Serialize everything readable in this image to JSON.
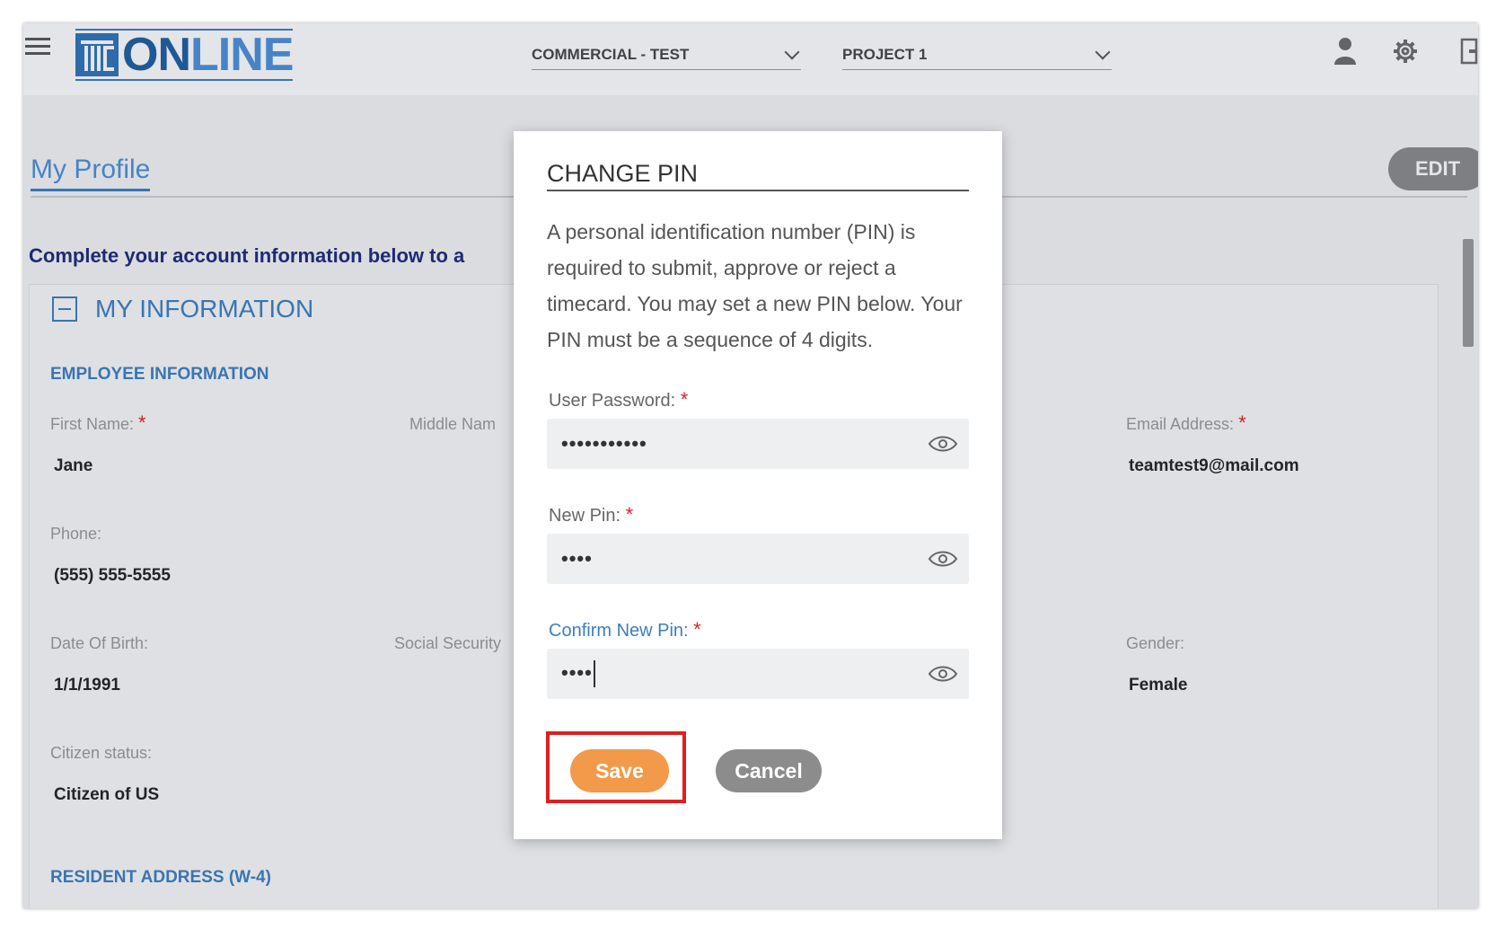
{
  "header": {
    "logo_text_1": "ON",
    "logo_text_2": "LINE",
    "company_select": "COMMERCIAL - TEST",
    "project_select": "PROJECT 1"
  },
  "page": {
    "tab": "My Profile",
    "edit_label": "EDIT",
    "intro": "Complete your account information below to a",
    "section_title": "MY INFORMATION",
    "employee_info_heading": "EMPLOYEE INFORMATION",
    "resident_address_heading": "RESIDENT ADDRESS (W-4)"
  },
  "fields": {
    "first_name": {
      "label": "First Name:",
      "value": "Jane"
    },
    "middle_name": {
      "label": "Middle Nam"
    },
    "email": {
      "label": "Email Address:",
      "value": "teamtest9@mail.com"
    },
    "phone": {
      "label": "Phone:",
      "value": "(555) 555-5555"
    },
    "dob": {
      "label": "Date Of Birth:",
      "value": "1/1/1991"
    },
    "ssn": {
      "label": "Social Security"
    },
    "gender": {
      "label": "Gender:",
      "value": "Female"
    },
    "citizen": {
      "label": "Citizen status:",
      "value": "Citizen of US"
    }
  },
  "modal": {
    "title": "CHANGE PIN",
    "description": "A personal identification number (PIN) is required to submit, approve or reject a timecard. You may set a new PIN below. Your PIN must be a sequence of 4 digits.",
    "user_password_label": "User Password:",
    "user_password_value": "•••••••••••",
    "new_pin_label": "New Pin:",
    "new_pin_value": "••••",
    "confirm_pin_label": "Confirm New Pin:",
    "confirm_pin_value": "••••",
    "save_label": "Save",
    "cancel_label": "Cancel",
    "required_mark": "*"
  },
  "colors": {
    "accent": "#3a7fc1",
    "save": "#f29a4a",
    "cancel": "#8c8c8c",
    "highlight": "#e01e1e",
    "required": "#e02020"
  },
  "icons": [
    "menu-icon",
    "logo-icon",
    "chevron-down-icon",
    "user-icon",
    "gear-icon",
    "logout-icon",
    "eye-icon",
    "collapse-icon"
  ]
}
